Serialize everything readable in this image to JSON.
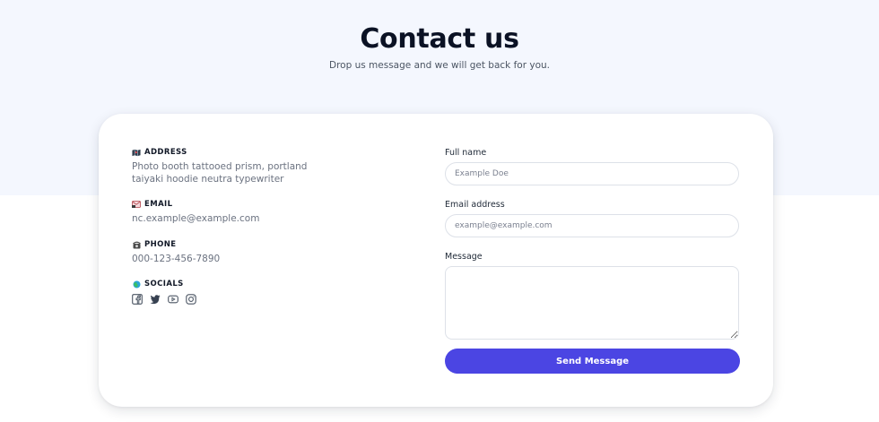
{
  "header": {
    "title": "Contact us",
    "subtitle": "Drop us message and we will get back for you."
  },
  "info": {
    "address": {
      "label": "ADDRESS",
      "icon": "map-icon",
      "text": "Photo booth tattooed prism, portland taiyaki hoodie neutra typewriter"
    },
    "email": {
      "label": "EMAIL",
      "icon": "envelope-icon",
      "text": "nc.example@example.com"
    },
    "phone": {
      "label": "PHONE",
      "icon": "phone-icon",
      "text": "000-123-456-7890"
    },
    "socials": {
      "label": "SOCIALS",
      "icon": "globe-icon",
      "items": [
        "facebook-icon",
        "twitter-icon",
        "youtube-icon",
        "instagram-icon"
      ]
    }
  },
  "form": {
    "full_name": {
      "label": "Full name",
      "placeholder": "Example Doe"
    },
    "email": {
      "label": "Email address",
      "placeholder": "example@example.com"
    },
    "message": {
      "label": "Message",
      "placeholder": ""
    },
    "submit_label": "Send Message"
  },
  "colors": {
    "hero_background": "#f4f7fe",
    "accent": "#4b45e3",
    "heading": "#0b1224",
    "muted_text": "#6b7280"
  }
}
